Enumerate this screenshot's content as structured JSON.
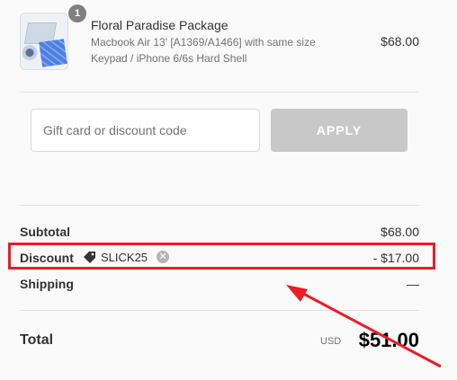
{
  "product": {
    "quantity": "1",
    "name": "Floral Paradise Package",
    "variant_line1": "Macbook Air 13' [A1369/A1466] with same size",
    "variant_line2": "Keypad / iPhone 6/6s Hard Shell",
    "price": "$68.00"
  },
  "discount_form": {
    "placeholder": "Gift card or discount code",
    "value": "",
    "apply_label": "APPLY"
  },
  "summary": {
    "subtotal_label": "Subtotal",
    "subtotal_value": "$68.00",
    "discount_label": "Discount",
    "discount_code": "SLICK25",
    "discount_value": "- $17.00",
    "shipping_label": "Shipping",
    "shipping_value": "—"
  },
  "total": {
    "label": "Total",
    "currency": "USD",
    "value": "$51.00"
  },
  "colors": {
    "annotation": "#ee1c24",
    "button_disabled": "#c8c8c8",
    "text": "#333333",
    "muted": "#737373"
  }
}
